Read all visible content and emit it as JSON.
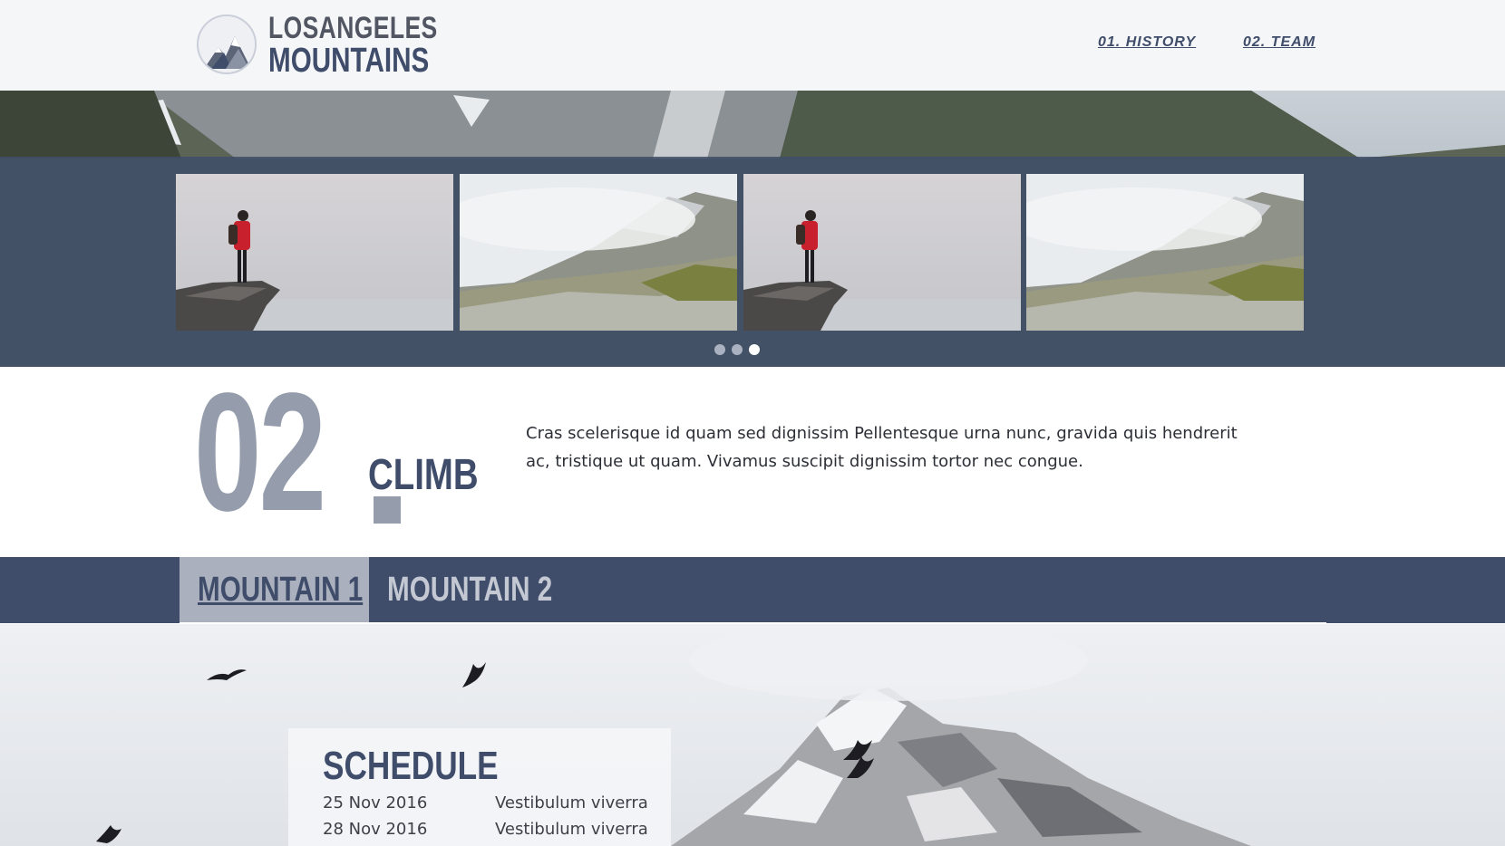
{
  "header": {
    "logo": {
      "line1": "LOSANGELES",
      "line2": "MOUNTAINS",
      "icon": "mountain-logo-icon"
    },
    "nav": [
      {
        "label": "01. HISTORY"
      },
      {
        "label": "02. TEAM"
      }
    ]
  },
  "carousel": {
    "slides": [
      {
        "image": "hiker-on-rock-in-fog"
      },
      {
        "image": "misty-mountain-valley"
      },
      {
        "image": "hiker-on-rock-in-fog"
      },
      {
        "image": "misty-mountain-valley"
      }
    ],
    "dots": 3,
    "active_dot": 3
  },
  "section": {
    "number": "02",
    "title": "CLIMB",
    "description": "Cras scelerisque id quam sed dignissim Pellentesque urna nunc, gravida quis hendrerit ac, tristique ut quam. Vivamus suscipit dignissim tortor nec congue."
  },
  "tabs": [
    {
      "label": "MOUNTAIN 1",
      "active": true
    },
    {
      "label": "MOUNTAIN 2",
      "active": false
    }
  ],
  "schedule": {
    "title": "SCHEDULE",
    "rows": [
      {
        "date": "25 Nov 2016",
        "text": "Vestibulum viverra"
      },
      {
        "date": "28 Nov 2016",
        "text": "Vestibulum viverra"
      }
    ]
  },
  "colors": {
    "primary": "#3f4d6b",
    "muted": "#959dac",
    "tab_active_bg": "#aab0bd",
    "header_bg": "#f5f6f8"
  }
}
